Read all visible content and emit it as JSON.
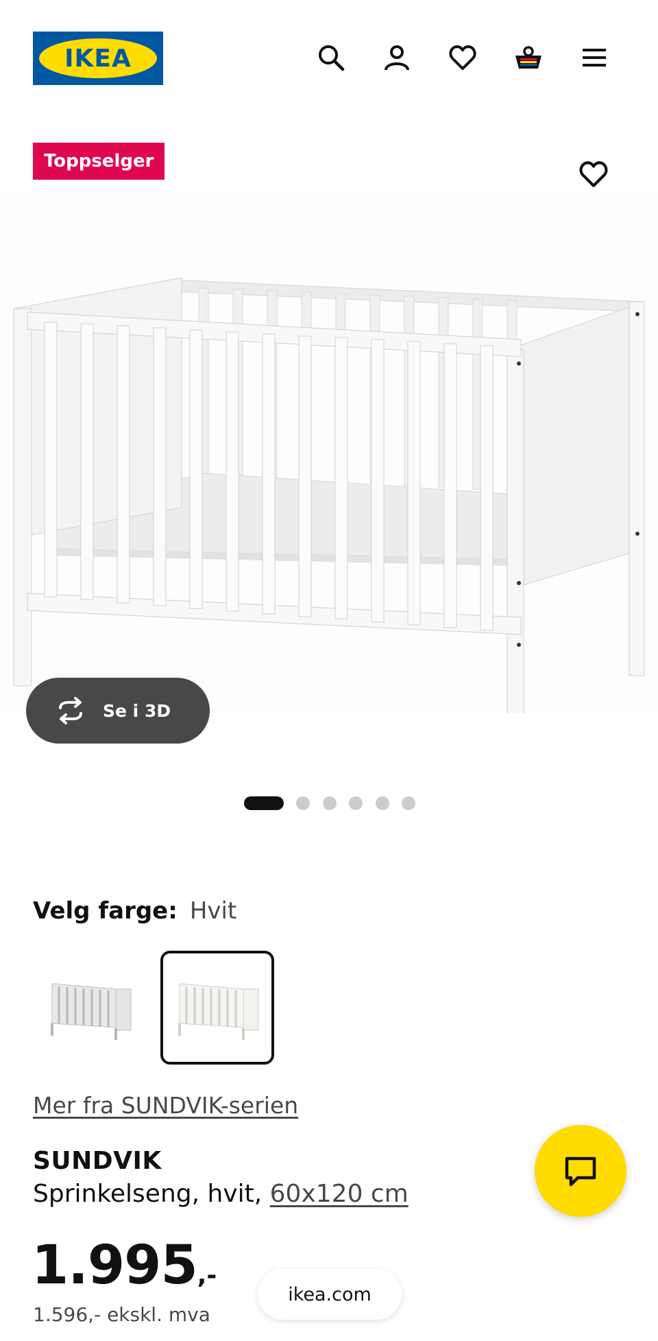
{
  "header": {
    "logo_text": "IKEA",
    "icons": [
      "search-icon",
      "account-icon",
      "favourites-icon",
      "cart-icon",
      "menu-icon"
    ]
  },
  "hero": {
    "badge": "Toppselger",
    "view_3d_label": "Se i 3D",
    "gallery": {
      "total": 6,
      "active_index": 0
    }
  },
  "color_picker": {
    "label": "Velg farge:",
    "selected": "Hvit",
    "swatch_count": 2,
    "selected_index": 1
  },
  "series_link": "Mer fra SUNDVIK-serien",
  "product": {
    "name": "SUNDVIK",
    "description": "Sprinkelseng, hvit,",
    "size": "60x120 cm"
  },
  "price": {
    "main": "1.995",
    "suffix": ",-",
    "ex_vat": "1.596,- ekskl. mva"
  },
  "url_bar": "ikea.com",
  "colors": {
    "ikea_blue": "#0058a3",
    "ikea_yellow": "#ffdb00",
    "badge_red": "#e00751",
    "button_dark": "#484848"
  }
}
